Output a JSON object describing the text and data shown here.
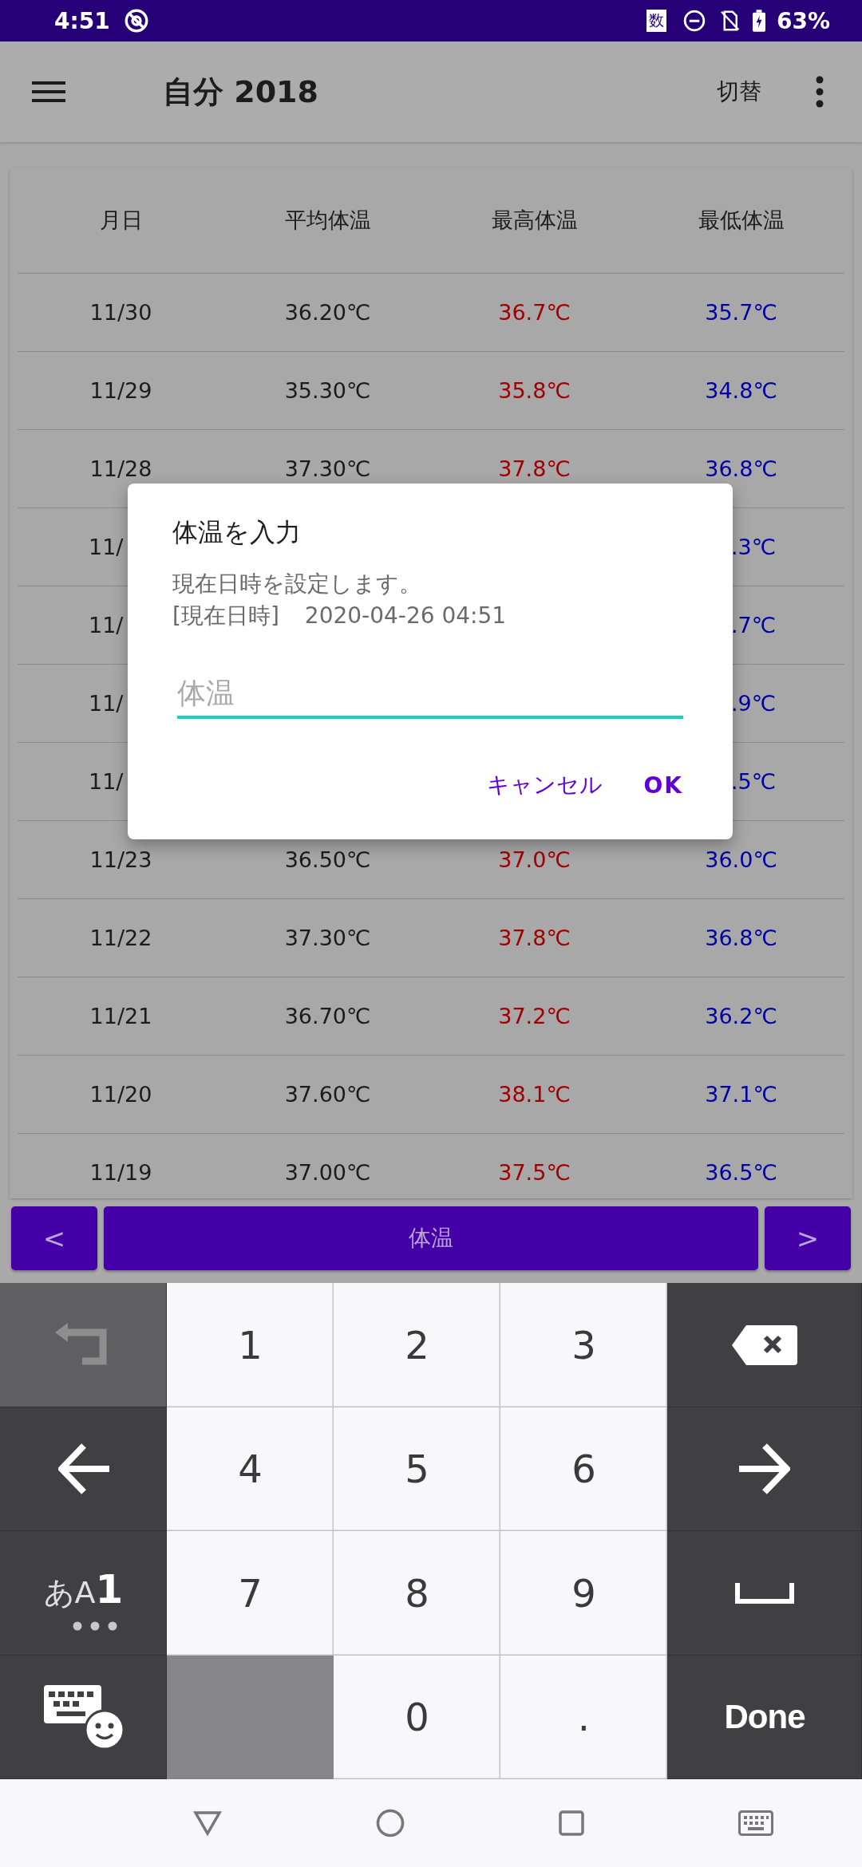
{
  "status_bar": {
    "time": "4:51",
    "ime_badge": "数",
    "battery": "63%"
  },
  "app_bar": {
    "title": "自分 2018",
    "action": "切替"
  },
  "table": {
    "columns": [
      "月日",
      "平均体温",
      "最高体温",
      "最低体温"
    ],
    "rows": [
      {
        "kind": "full",
        "cells": [
          "11/30",
          "36.20℃",
          "36.7℃",
          "35.7℃"
        ]
      },
      {
        "kind": "full",
        "cells": [
          "11/29",
          "35.30℃",
          "35.8℃",
          "34.8℃"
        ]
      },
      {
        "kind": "full",
        "cells": [
          "11/28",
          "37.30℃",
          "37.8℃",
          "36.8℃"
        ]
      },
      {
        "kind": "partial",
        "cells": [
          "11/",
          ".3℃"
        ]
      },
      {
        "kind": "partial",
        "cells": [
          "11/",
          ".7℃"
        ]
      },
      {
        "kind": "partial",
        "cells": [
          "11/",
          ".9℃"
        ]
      },
      {
        "kind": "partial",
        "cells": [
          "11/",
          ".5℃"
        ]
      },
      {
        "kind": "full",
        "cells": [
          "11/23",
          "36.50℃",
          "37.0℃",
          "36.0℃"
        ]
      },
      {
        "kind": "full",
        "cells": [
          "11/22",
          "37.30℃",
          "37.8℃",
          "36.8℃"
        ]
      },
      {
        "kind": "full",
        "cells": [
          "11/21",
          "36.70℃",
          "37.2℃",
          "36.2℃"
        ]
      },
      {
        "kind": "full",
        "cells": [
          "11/20",
          "37.60℃",
          "38.1℃",
          "37.1℃"
        ]
      },
      {
        "kind": "full",
        "cells": [
          "11/19",
          "37.00℃",
          "37.5℃",
          "36.5℃"
        ]
      }
    ]
  },
  "bottom_bar": {
    "prev": "<",
    "label": "体温",
    "next": ">"
  },
  "dialog": {
    "title": "体温を入力",
    "message": "現在日時を設定します。",
    "datetime_label": "[現在日時]",
    "datetime": "2020-04-26 04:51",
    "field": {
      "placeholder": "体温"
    },
    "buttons": [
      "キャンセル",
      "OK"
    ]
  },
  "keyboard": {
    "keys": [
      {
        "kind": "undo"
      },
      {
        "kind": "digit",
        "label": "1"
      },
      {
        "kind": "digit",
        "label": "2"
      },
      {
        "kind": "digit",
        "label": "3"
      },
      {
        "kind": "backspace"
      },
      {
        "kind": "left"
      },
      {
        "kind": "digit",
        "label": "4"
      },
      {
        "kind": "digit",
        "label": "5"
      },
      {
        "kind": "digit",
        "label": "6"
      },
      {
        "kind": "right"
      },
      {
        "kind": "mode",
        "label": "あA**1**"
      },
      {
        "kind": "digit",
        "label": "7"
      },
      {
        "kind": "digit",
        "label": "8"
      },
      {
        "kind": "digit",
        "label": "9"
      },
      {
        "kind": "space"
      },
      {
        "kind": "emoji"
      },
      {
        "kind": "blank"
      },
      {
        "kind": "digit",
        "label": "0"
      },
      {
        "kind": "digit",
        "label": "."
      },
      {
        "kind": "done",
        "label": "Done"
      }
    ]
  }
}
